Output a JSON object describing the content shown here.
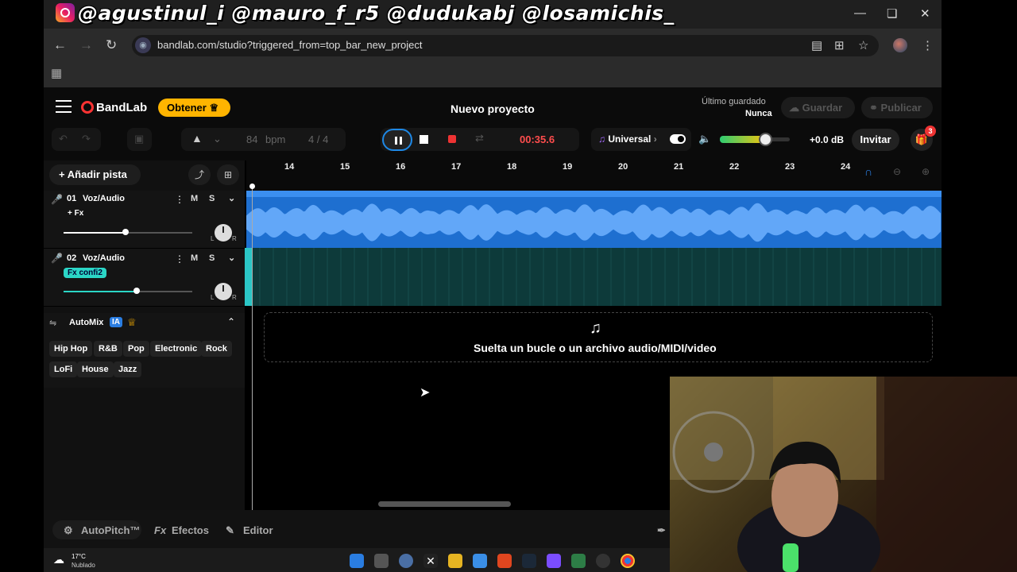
{
  "overlay_text": "@agustinul_i  @mauro_f_r5  @dudukabj @losamichis_",
  "browser": {
    "url": "bandlab.com/studio?triggered_from=top_bar_new_project",
    "icons": [
      "back-icon",
      "forward-icon",
      "reload-icon",
      "reading-mode-icon",
      "install-icon",
      "star-icon",
      "menu-icon",
      "apps-icon"
    ]
  },
  "header": {
    "brand": "BandLab",
    "upgrade_label": "Obtener",
    "project_title": "Nuevo proyecto",
    "last_saved_label": "Último guardado",
    "last_saved_value": "Nunca",
    "save_label": "Guardar",
    "publish_label": "Publicar"
  },
  "toolbar": {
    "bpm_value": "84",
    "bpm_label": "bpm",
    "time_signature": "4 / 4",
    "time": "00:35.6",
    "universal_label": "Universal",
    "volume_level": 0.65,
    "db_label": "+0.0 dB",
    "invite_label": "Invitar",
    "gift_badge": "3"
  },
  "left_panel": {
    "add_track_label": "Añadir pista",
    "tracks": [
      {
        "number": "01",
        "name": "Voz/Audio",
        "fx_label": "+ Fx",
        "mute": "M",
        "solo": "S",
        "volume": 0.8
      },
      {
        "number": "02",
        "name": "Voz/Audio",
        "fx_label": "Fx confi2",
        "mute": "M",
        "solo": "S",
        "volume": 0.95
      }
    ],
    "pan_left": "L",
    "pan_right": "R",
    "automix_label": "AutoMix",
    "ia_badge": "IA",
    "genres": [
      "Hip Hop",
      "R&B",
      "Pop",
      "Electronic",
      "Rock",
      "LoFi",
      "House",
      "Jazz"
    ]
  },
  "timeline": {
    "ruler": [
      "14",
      "15",
      "16",
      "17",
      "18",
      "19",
      "20",
      "21",
      "22",
      "23",
      "24"
    ],
    "drop_text": "Suelta un bucle o un archivo audio/MIDI/video"
  },
  "bottom_bar": {
    "autopitch_label": "AutoPitch™",
    "effects_label": "Efectos",
    "editor_label": "Editor"
  },
  "taskbar": {
    "temperature": "17°C",
    "weather": "Nublado"
  },
  "colors": {
    "accent": "#1e88e5",
    "upgrade": "#ffb400",
    "record": "#ff4d4d",
    "clip_blue": "#1e6fd0",
    "clip_teal": "#0d3a3a"
  }
}
